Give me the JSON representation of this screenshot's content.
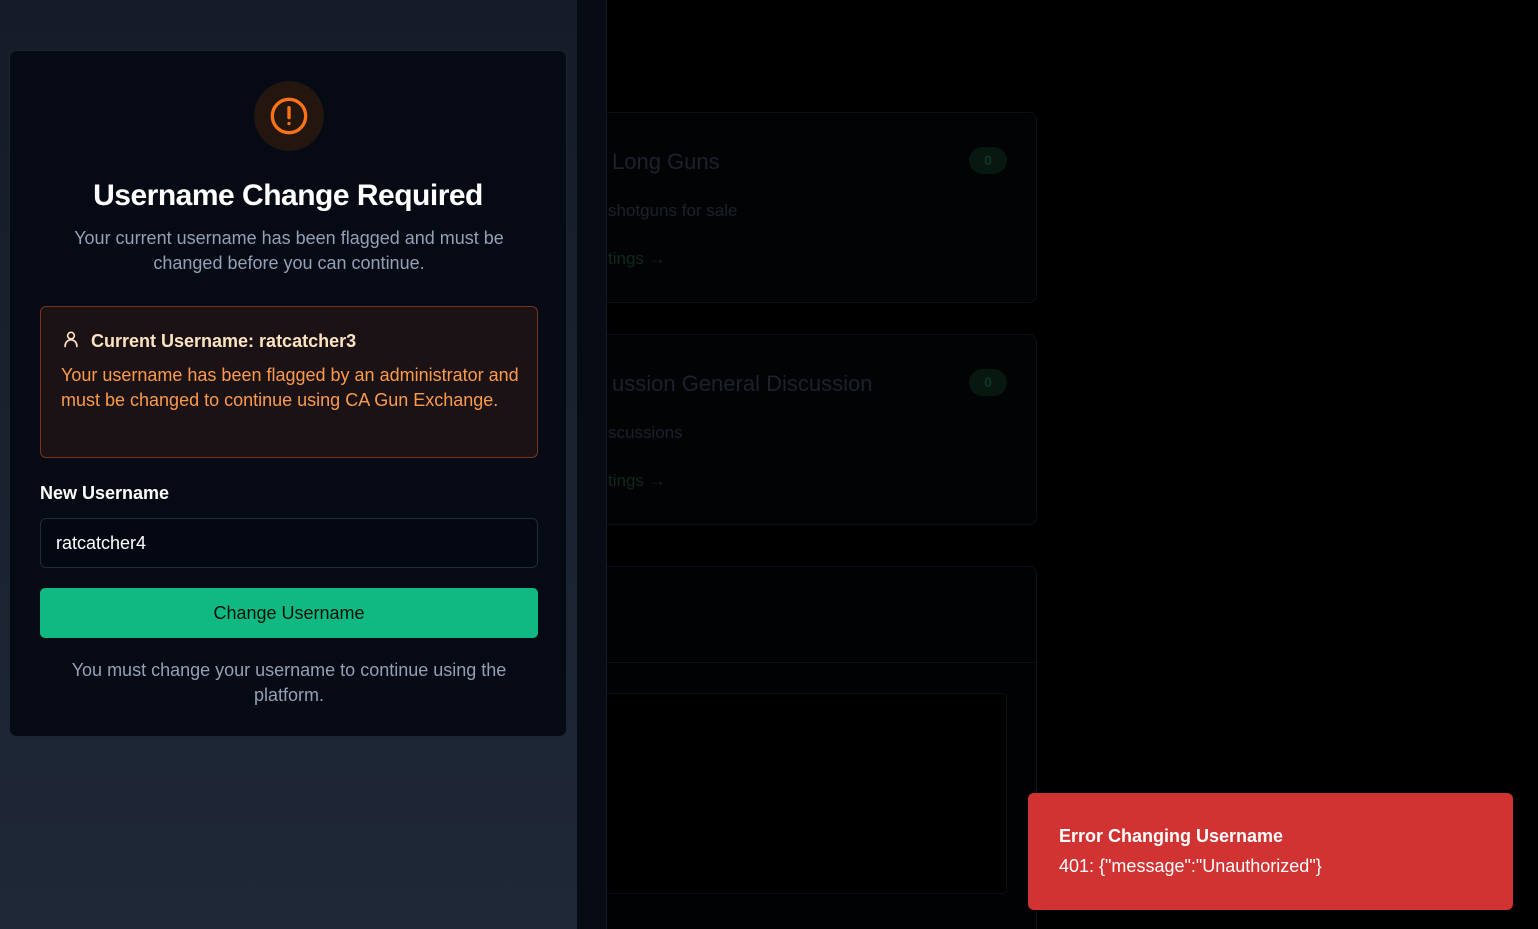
{
  "background": {
    "cards": [
      {
        "title": "Long Guns",
        "description": "shotguns for sale",
        "link": "tings →",
        "count": "0"
      },
      {
        "title": "ussion General Discussion",
        "description": "scussions",
        "link": "tings →",
        "count": "0"
      }
    ]
  },
  "modal": {
    "icon": "alert-circle-icon",
    "title": "Username Change Required",
    "subtitle": "Your current username has been flagged and must be changed before you can continue.",
    "alert": {
      "icon": "user-icon",
      "heading": "Current Username: ratcatcher3",
      "body": "Your username has been flagged by an administrator and must be changed to continue using CA Gun Exchange."
    },
    "field_label": "New Username",
    "field_value": "ratcatcher4",
    "submit_label": "Change Username",
    "footer_note": "You must change your username to continue using the platform."
  },
  "toast": {
    "title": "Error Changing Username",
    "message": "401: {\"message\":\"Unauthorized\"}"
  },
  "colors": {
    "accent": "#10b981",
    "warning": "#f97316",
    "error": "#d13232"
  }
}
